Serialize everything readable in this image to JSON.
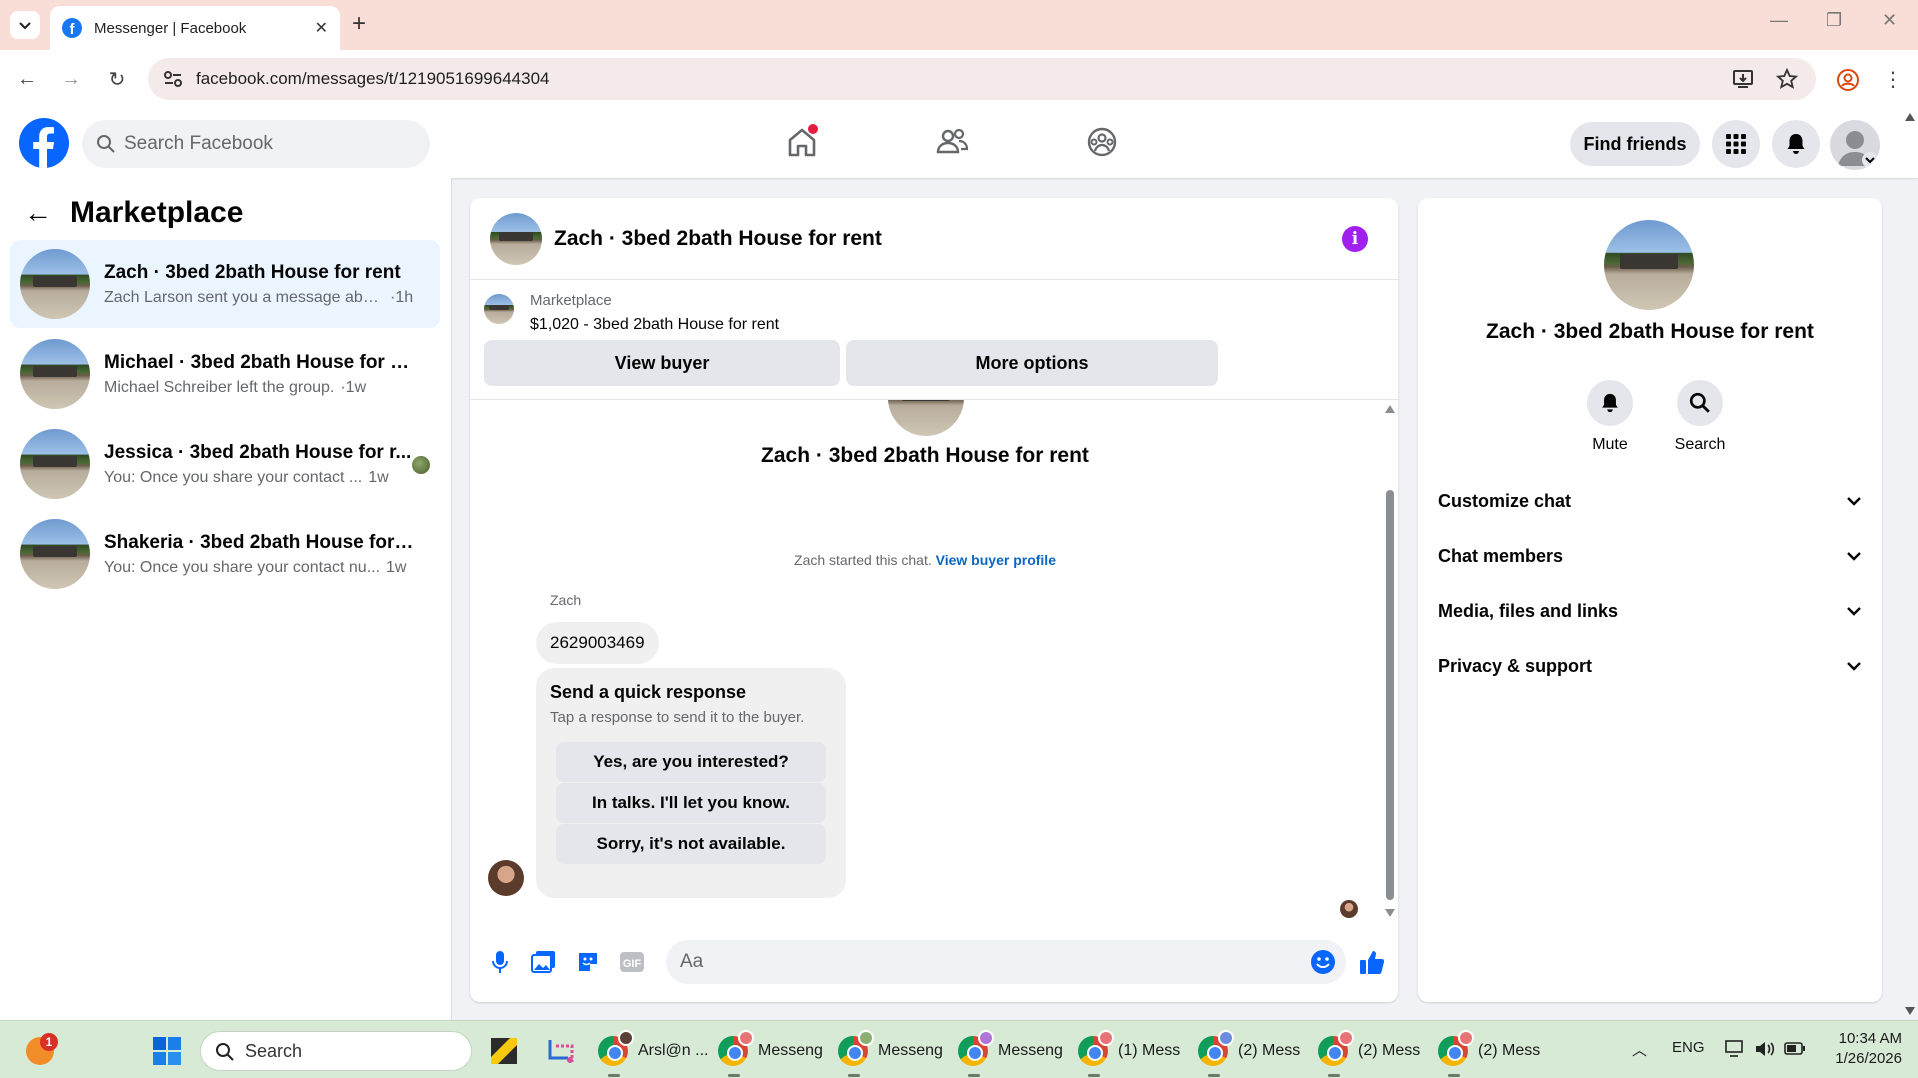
{
  "browser": {
    "tab_title": "Messenger | Facebook",
    "url": "facebook.com/messages/t/1219051699644304",
    "window_controls": [
      "minimize-icon",
      "restore-icon",
      "close-icon"
    ]
  },
  "fb_header": {
    "search_placeholder": "Search Facebook",
    "find_friends": "Find friends",
    "nav_icons": [
      "home-icon",
      "friends-icon",
      "groups-icon"
    ],
    "has_home_notification": true
  },
  "sidebar": {
    "title": "Marketplace",
    "conversations": [
      {
        "name": "Zach · 3bed 2bath House for rent",
        "snippet": "Zach Larson sent you a message abou...",
        "time": "·1h",
        "active": true
      },
      {
        "name": "Michael · 3bed 2bath House for rent",
        "snippet": "Michael Schreiber left the group.",
        "time": "·1w",
        "active": false
      },
      {
        "name": "Jessica · 3bed 2bath House for r...",
        "snippet": "You: Once you share your contact ...",
        "time": "1w",
        "active": false
      },
      {
        "name": "Shakeria · 3bed 2bath House for re...",
        "snippet": "You: Once you share your contact nu...",
        "time": "1w",
        "active": false
      }
    ]
  },
  "chat": {
    "title": "Zach · 3bed 2bath House for rent",
    "listing_source": "Marketplace",
    "listing_price_title": "$1,020 - 3bed 2bath House for rent",
    "view_buyer": "View buyer",
    "more_options": "More options",
    "convo_title": "Zach · 3bed 2bath House for rent",
    "started_text": "Zach started this chat.",
    "view_buyer_profile": "View buyer profile",
    "sender_name": "Zach",
    "message": "2629003469",
    "quick_response": {
      "heading": "Send a quick response",
      "subtitle": "Tap a response to send it to the buyer.",
      "options": [
        "Yes, are you interested?",
        "In talks. I'll let you know.",
        "Sorry, it's not available."
      ]
    },
    "input_placeholder": "Aa"
  },
  "info_panel": {
    "title": "Zach · 3bed 2bath House for rent",
    "mute_label": "Mute",
    "search_label": "Search",
    "sections": [
      "Customize chat",
      "Chat members",
      "Media, files and links",
      "Privacy & support"
    ]
  },
  "taskbar": {
    "search_placeholder": "Search",
    "notification_count": "1",
    "apps": [
      "Arsl@n ...",
      "Messeng",
      "Messeng",
      "Messeng",
      "(1) Mess",
      "(2) Mess",
      "(2) Mess",
      "(2) Mess"
    ],
    "lang": "ENG",
    "time": "10:34 AM",
    "date": "1/26/2026"
  }
}
